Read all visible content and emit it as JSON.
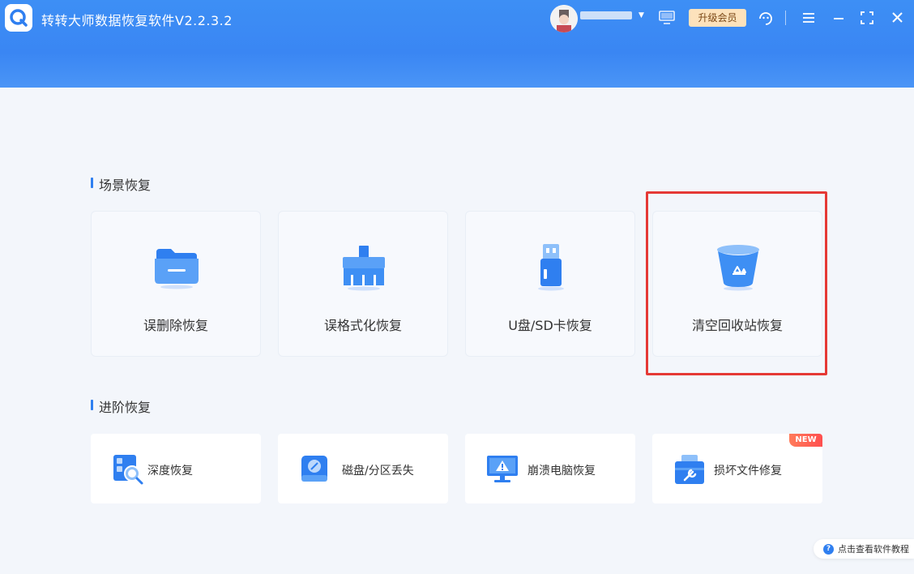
{
  "app": {
    "title": "转转大师数据恢复软件V2.2.3.2",
    "vip_label": "升级会员"
  },
  "sections": {
    "scene_title": "场景恢复",
    "advanced_title": "进阶恢复"
  },
  "scene_cards": [
    {
      "label": "误删除恢复",
      "icon": "folder-icon"
    },
    {
      "label": "误格式化恢复",
      "icon": "broom-icon"
    },
    {
      "label": "U盘/SD卡恢复",
      "icon": "usb-drive-icon"
    },
    {
      "label": "清空回收站恢复",
      "icon": "recycle-bin-icon"
    }
  ],
  "advanced_cards": [
    {
      "label": "深度恢复",
      "icon": "deep-scan-icon"
    },
    {
      "label": "磁盘/分区丢失",
      "icon": "disk-icon"
    },
    {
      "label": "崩溃电脑恢复",
      "icon": "crashed-monitor-icon"
    },
    {
      "label": "损坏文件修复",
      "icon": "repair-toolbox-icon",
      "badge": "NEW"
    }
  ],
  "footer": {
    "tutorial_label": "点击查看软件教程",
    "help_glyph": "?"
  },
  "colors": {
    "header": "#3a86f3",
    "accent": "#2f7ff0",
    "vip_bg": "#fde2bc",
    "highlight": "#e53935"
  }
}
